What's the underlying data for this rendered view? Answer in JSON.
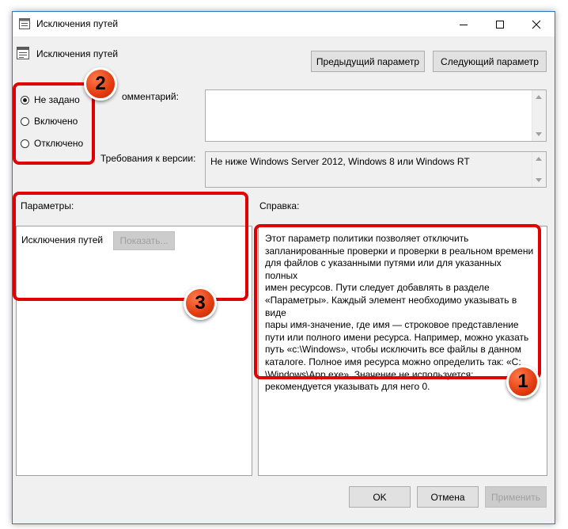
{
  "window": {
    "title": "Исключения путей"
  },
  "policy": {
    "name": "Исключения путей"
  },
  "nav": {
    "prev_label": "Предыдущий параметр",
    "next_label": "Следующий параметр"
  },
  "state": {
    "options": [
      {
        "label": "Не задано",
        "checked": true
      },
      {
        "label": "Включено",
        "checked": false
      },
      {
        "label": "Отключено",
        "checked": false
      }
    ]
  },
  "comment": {
    "label": "омментарий:",
    "value": ""
  },
  "supported": {
    "label": "Требования к версии:",
    "value": "Не ниже Windows Server 2012, Windows 8 или Windows RT"
  },
  "params": {
    "header": "Параметры:",
    "item_label": "Исключения путей",
    "show_button": "Показать..."
  },
  "help": {
    "header": "Справка:",
    "text": "Этот параметр политики позволяет отключить\nзапланированные проверки и проверки в реальном времени\nдля файлов с указанными путями или для указанных полных\nимен ресурсов. Пути следует добавлять в разделе\n«Параметры». Каждый элемент необходимо указывать в виде\nпары имя-значение, где имя — строковое представление\nпути или полного имени ресурса. Например, можно указать\nпуть «c:\\Windows», чтобы исключить все файлы в данном\nкаталоге. Полное имя ресурса можно определить так: «C:\n\\Windows\\App.exe». Значение не используется;\nрекомендуется указывать для него 0."
  },
  "footer": {
    "ok": "OK",
    "cancel": "Отмена",
    "apply": "Применить"
  },
  "annotations": {
    "badge_1": "1",
    "badge_2": "2",
    "badge_3": "3",
    "color": "#e00000"
  }
}
